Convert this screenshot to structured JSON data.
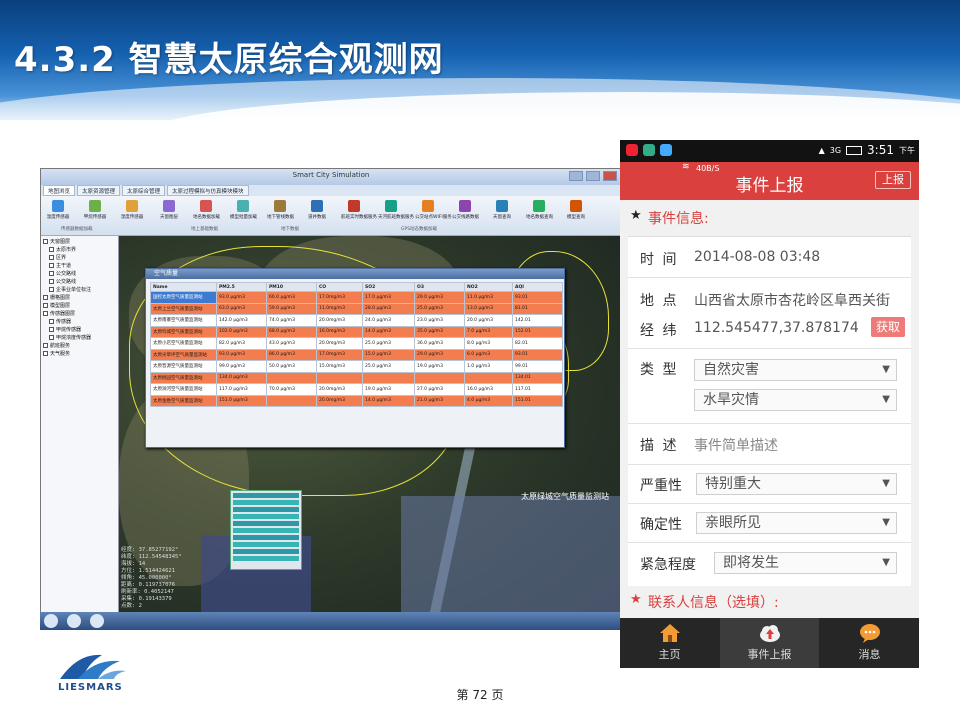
{
  "slide": {
    "title": "4.3.2 智慧太原综合观测网",
    "page_label": "第 72 页",
    "logo_text": "LIESMARS"
  },
  "desktop": {
    "window_title": "Smart City Simulation",
    "tabs": [
      "地图浏览",
      "太原资源管理",
      "太原综合管理",
      "太原过程模拟与仿真模块模块"
    ],
    "ribbon_buttons": [
      "温度传感器",
      "甲烷传感器",
      "湿度传感器",
      "天窗图层",
      "地名数据加载",
      "模型批量加载",
      "地下管线数据",
      "道井数据",
      "航班实时数据服务",
      "天河航班数据服务",
      "公交站点WIFI服务",
      "公交线路数据",
      "天窗查询",
      "地名数据查询",
      "模型查询"
    ],
    "ribbon_groups": [
      "传感器数据加载",
      "地上基础数据",
      "地下数据",
      "GPS动态数据加载"
    ],
    "tree": [
      {
        "label": "天窗图层",
        "level": 1
      },
      {
        "label": "太原市界",
        "level": 2
      },
      {
        "label": "区界",
        "level": 2
      },
      {
        "label": "主干道",
        "level": 2
      },
      {
        "label": "公交路线",
        "level": 2
      },
      {
        "label": "公交路线",
        "level": 2
      },
      {
        "label": "企事业单位标注",
        "level": 2
      },
      {
        "label": "栅格图层",
        "level": 1
      },
      {
        "label": "模型图层",
        "level": 1
      },
      {
        "label": "传感器图层",
        "level": 1
      },
      {
        "label": "传感器",
        "level": 2
      },
      {
        "label": "甲烷传感器",
        "level": 2
      },
      {
        "label": "甲烷浓度传感器",
        "level": 2
      },
      {
        "label": "航班服务",
        "level": 1
      },
      {
        "label": "天气服务",
        "level": 1
      }
    ],
    "map_labels": [
      "太原绿城空气质量监测站"
    ],
    "coords": [
      "经度: 37.85277192°",
      "纬度: 112.54548345°",
      "海拔: 14",
      "方位: 1.514424621",
      "倾角: 45.000000°",
      "距离: 0.119737076",
      "刷新率: 0.4052147",
      "采集: 0.19143379",
      "点数: 2"
    ]
  },
  "air_quality": {
    "title": "空气质量",
    "columns": [
      "Name",
      "PM2.5",
      "PM10",
      "CO",
      "SO2",
      "O3",
      "NO2",
      "AQI"
    ],
    "rows": [
      {
        "style": "o",
        "selected": true,
        "cells": [
          "国控太原空气质量监测站",
          "93.0 μg/m3",
          "66.0 μg/m3",
          "17.0mg/m3",
          "17.0 μg/m3",
          "29.0 μg/m3",
          "11.0 μg/m3",
          "93.01"
        ]
      },
      {
        "style": "o",
        "cells": [
          "太原上兰空气质量监测站",
          "63.0 μg/m3",
          "59.0 μg/m3",
          "11.0mg/m3",
          "28.0 μg/m3",
          "25.0 μg/m3",
          "13.0 μg/m3",
          "81.01"
        ]
      },
      {
        "style": "w",
        "cells": [
          "太原南寨空气质量监测站",
          "142.0 μg/m3",
          "74.0 μg/m3",
          "20.0mg/m3",
          "24.0 μg/m3",
          "23.0 μg/m3",
          "20.0 μg/m3",
          "142.01"
        ]
      },
      {
        "style": "o",
        "cells": [
          "太原坞城空气质量监测站",
          "102.0 μg/m3",
          "68.0 μg/m3",
          "16.0mg/m3",
          "14.0 μg/m3",
          "35.0 μg/m3",
          "7.0 μg/m3",
          "152.01"
        ]
      },
      {
        "style": "w",
        "cells": [
          "太原小店空气质量监测站",
          "82.0 μg/m3",
          "43.0 μg/m3",
          "20.0mg/m3",
          "25.0 μg/m3",
          "36.0 μg/m3",
          "8.0 μg/m3",
          "82.01"
        ]
      },
      {
        "style": "o",
        "cells": [
          "太原尖草坪空气质量监测站",
          "93.0 μg/m3",
          "86.0 μg/m3",
          "17.0mg/m3",
          "15.0 μg/m3",
          "29.0 μg/m3",
          "6.0 μg/m3",
          "93.01"
        ]
      },
      {
        "style": "w",
        "cells": [
          "太原晋源空气质量监测站",
          "99.0 μg/m3",
          "50.0 μg/m3",
          "15.0mg/m3",
          "25.0 μg/m3",
          "19.0 μg/m3",
          "1.0 μg/m3",
          "99.01"
        ]
      },
      {
        "style": "o",
        "cells": [
          "太原桃园空气质量监测站",
          "134.0 μg/m3",
          "",
          "",
          "",
          "",
          "",
          "134.01"
        ]
      },
      {
        "style": "w",
        "cells": [
          "太原涧河空气质量监测站",
          "117.0 μg/m3",
          "70.0 μg/m3",
          "20.0mg/m3",
          "19.0 μg/m3",
          "27.0 μg/m3",
          "16.0 μg/m3",
          "117.01"
        ]
      },
      {
        "style": "o",
        "cells": [
          "太原金胜空气质量监测站",
          "151.0 μg/m3",
          "",
          "20.0mg/m3",
          "14.0 μg/m3",
          "21.0 μg/m3",
          "4.0 μg/m3",
          "151.01"
        ]
      }
    ]
  },
  "phone": {
    "status": {
      "net": "3G",
      "time": "3:51",
      "ampm": "下午"
    },
    "speed": "40B/S",
    "header_title": "事件上报",
    "submit_label": "上报",
    "section_event": "事件信息:",
    "section_contact": "联系人信息（选填）:",
    "time_label": "时 间",
    "time_value": "2014-08-08 03:48",
    "place_label": "地 点",
    "place_value": "山西省太原市杏花岭区阜西关街",
    "lnglat_label": "经 纬",
    "lnglat_value": "112.545477,37.878174",
    "get_label": "获取",
    "type_label": "类 型",
    "type_value": "自然灾害",
    "subtype_value": "水旱灾情",
    "desc_label": "描 述",
    "desc_value": "事件简单描述",
    "severity_label": "严重性",
    "severity_value": "特别重大",
    "confirm_label": "确定性",
    "confirm_value": "亲眼所见",
    "urgency_label": "紧急程度",
    "urgency_value": "即将发生",
    "tabs": [
      "主页",
      "事件上报",
      "消息"
    ],
    "accent": "#d9403e"
  }
}
